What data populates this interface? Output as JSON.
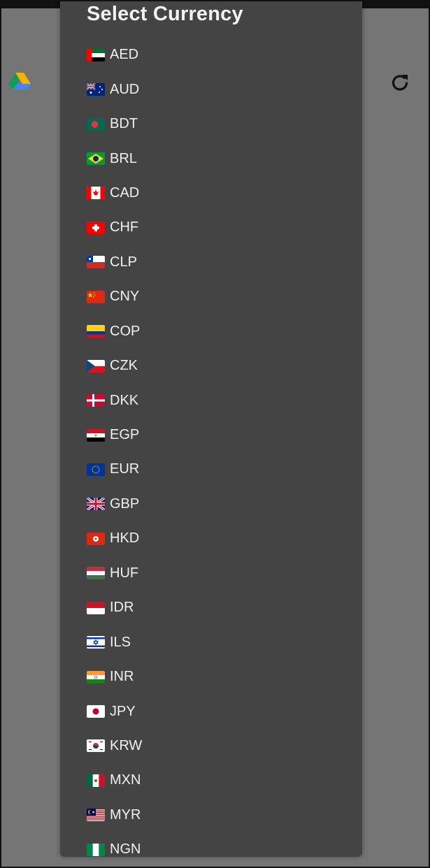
{
  "dialog": {
    "title": "Select Currency"
  },
  "background": {
    "left_icon": "google-drive-icon",
    "right_icon": "refresh-icon"
  },
  "currencies": [
    {
      "code": "AED",
      "flag": "uae"
    },
    {
      "code": "AUD",
      "flag": "australia"
    },
    {
      "code": "BDT",
      "flag": "bangladesh"
    },
    {
      "code": "BRL",
      "flag": "brazil"
    },
    {
      "code": "CAD",
      "flag": "canada"
    },
    {
      "code": "CHF",
      "flag": "switzerland"
    },
    {
      "code": "CLP",
      "flag": "chile"
    },
    {
      "code": "CNY",
      "flag": "china"
    },
    {
      "code": "COP",
      "flag": "colombia"
    },
    {
      "code": "CZK",
      "flag": "czechia"
    },
    {
      "code": "DKK",
      "flag": "denmark"
    },
    {
      "code": "EGP",
      "flag": "egypt"
    },
    {
      "code": "EUR",
      "flag": "eu"
    },
    {
      "code": "GBP",
      "flag": "uk"
    },
    {
      "code": "HKD",
      "flag": "hongkong"
    },
    {
      "code": "HUF",
      "flag": "hungary"
    },
    {
      "code": "IDR",
      "flag": "indonesia"
    },
    {
      "code": "ILS",
      "flag": "israel"
    },
    {
      "code": "INR",
      "flag": "india"
    },
    {
      "code": "JPY",
      "flag": "japan"
    },
    {
      "code": "KRW",
      "flag": "southkorea"
    },
    {
      "code": "MXN",
      "flag": "mexico"
    },
    {
      "code": "MYR",
      "flag": "malaysia"
    },
    {
      "code": "NGN",
      "flag": "nigeria"
    }
  ]
}
